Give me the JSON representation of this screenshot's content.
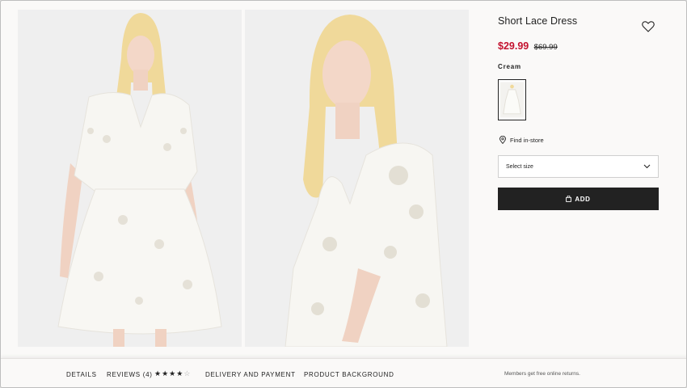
{
  "product": {
    "title": "Short Lace Dress",
    "price_now": "$29.99",
    "price_old": "$69.99",
    "color_label": "Cream",
    "find_in_store": "Find in-store",
    "size_placeholder": "Select size",
    "add_label": "ADD"
  },
  "icons": {
    "wishlist": "heart-icon",
    "store": "location-pin-icon",
    "dropdown": "chevron-down-icon",
    "bag": "bag-icon"
  },
  "tabs": {
    "details": "DETAILS",
    "reviews": "REVIEWS (4)",
    "delivery": "DELIVERY AND PAYMENT",
    "background": "PRODUCT BACKGROUND"
  },
  "rating": {
    "stars": 4,
    "max": 5
  },
  "returns_note": "Members get free online returns.",
  "colors": {
    "sale_red": "#c4122f",
    "button_dark": "#222222",
    "photo_bg": "#efefef"
  }
}
